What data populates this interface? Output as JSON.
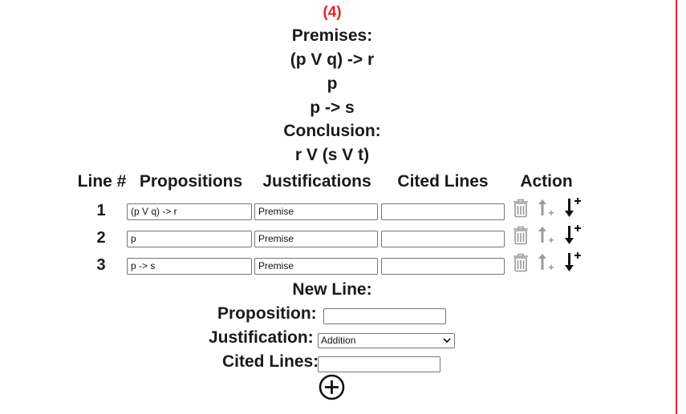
{
  "problem": {
    "number": "(4)",
    "premises_label": "Premises:",
    "premises": [
      "(p V q) -> r",
      "p",
      "p -> s"
    ],
    "conclusion_label": "Conclusion:",
    "conclusion": "r V (s V t)"
  },
  "table": {
    "headers": {
      "line": "Line #",
      "propositions": "Propositions",
      "justifications": "Justifications",
      "cited_lines": "Cited Lines",
      "action": "Action"
    },
    "rows": [
      {
        "line": "1",
        "proposition": "(p V q) -> r",
        "justification": "Premise",
        "cited": ""
      },
      {
        "line": "2",
        "proposition": "p",
        "justification": "Premise",
        "cited": ""
      },
      {
        "line": "3",
        "proposition": "p -> s",
        "justification": "Premise",
        "cited": ""
      }
    ]
  },
  "new_line": {
    "title": "New Line:",
    "proposition_label": "Proposition:",
    "proposition_value": "",
    "justification_label": "Justification:",
    "justification_selected": "Addition",
    "cited_label": "Cited Lines:",
    "cited_value": ""
  },
  "icons": {
    "delete": "trash-icon",
    "move_up": "move-up-icon",
    "insert_below": "insert-below-icon",
    "add": "add-circle-icon"
  },
  "colors": {
    "accent_red": "#e3262c",
    "disabled_gray": "#9a9a9a",
    "text": "#1a1a1a"
  }
}
